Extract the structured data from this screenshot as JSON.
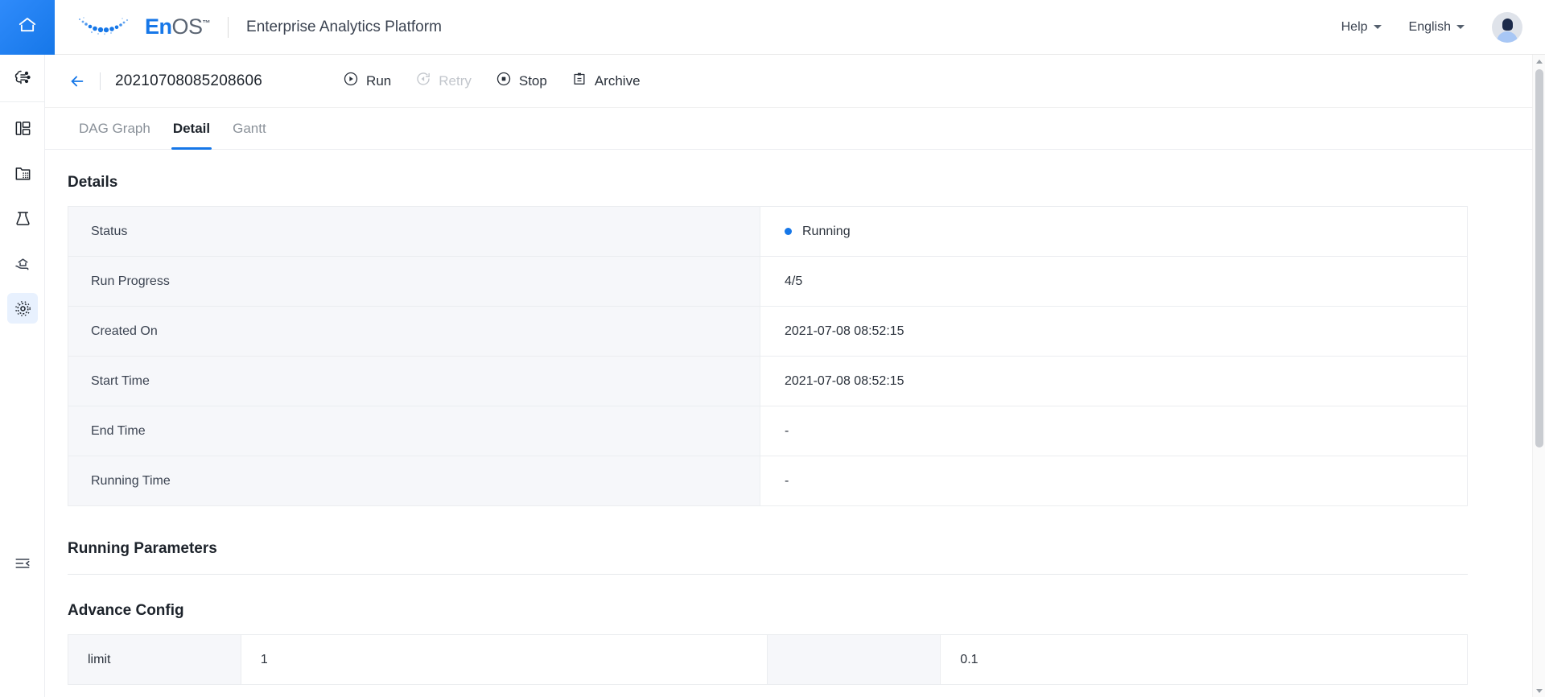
{
  "header": {
    "home_icon": "home-icon",
    "logo_en": "En",
    "logo_os": "OS",
    "logo_tm": "™",
    "product_title": "Enterprise Analytics Platform",
    "help_label": "Help",
    "language_label": "English",
    "accent_color": "#1677e8"
  },
  "rail": {
    "items": [
      {
        "icon": "ai-model-icon",
        "name": "sidebar-item-ai-model",
        "active": false
      },
      {
        "icon": "dashboard-icon",
        "name": "sidebar-item-dashboard",
        "active": false
      },
      {
        "icon": "data-folder-icon",
        "name": "sidebar-item-data-folder",
        "active": false
      },
      {
        "icon": "lab-flask-icon",
        "name": "sidebar-item-lab",
        "active": false
      },
      {
        "icon": "service-hand-icon",
        "name": "sidebar-item-service",
        "active": false
      },
      {
        "icon": "settings-gear-icon",
        "name": "sidebar-item-settings",
        "active": true
      }
    ],
    "collapse_icon": "collapse-menu-icon"
  },
  "page": {
    "back_icon": "back-arrow-icon",
    "run_id": "20210708085208606",
    "actions": [
      {
        "label": "Run",
        "icon": "play-circle-icon",
        "disabled": false
      },
      {
        "label": "Retry",
        "icon": "retry-circle-icon",
        "disabled": true
      },
      {
        "label": "Stop",
        "icon": "stop-circle-icon",
        "disabled": false
      },
      {
        "label": "Archive",
        "icon": "archive-box-icon",
        "disabled": false
      }
    ],
    "tabs": [
      {
        "label": "DAG Graph",
        "active": false
      },
      {
        "label": "Detail",
        "active": true
      },
      {
        "label": "Gantt",
        "active": false
      }
    ]
  },
  "details": {
    "title": "Details",
    "rows": [
      {
        "key": "Status",
        "value": "Running",
        "status": true,
        "dot_color": "#1677e8"
      },
      {
        "key": "Run Progress",
        "value": "4/5",
        "status": false
      },
      {
        "key": "Created On",
        "value": "2021-07-08 08:52:15",
        "status": false
      },
      {
        "key": "Start Time",
        "value": "2021-07-08 08:52:15",
        "status": false
      },
      {
        "key": "End Time",
        "value": "-",
        "status": false
      },
      {
        "key": "Running Time",
        "value": "-",
        "status": false
      }
    ]
  },
  "running_parameters": {
    "title": "Running Parameters"
  },
  "advance_config": {
    "title": "Advance Config",
    "rows": [
      {
        "k1": "limit",
        "v1": "1",
        "k2": "",
        "v2": "0.1"
      }
    ]
  }
}
